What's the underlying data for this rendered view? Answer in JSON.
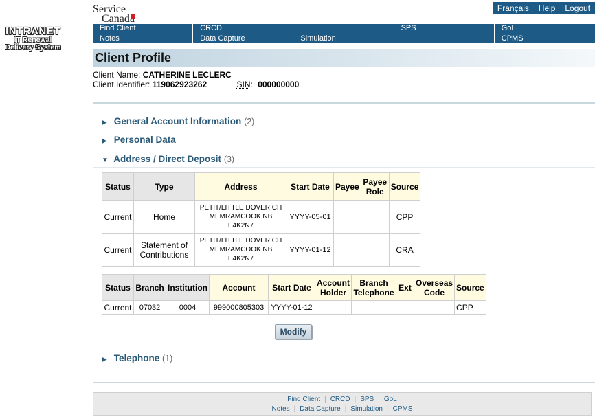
{
  "logo": {
    "intranet_big": "INTRANET",
    "intranet_line2": "IT Renewal",
    "intranet_line3": "Delivery System",
    "service_canada_line1": "Service",
    "service_canada_line2": "Canada"
  },
  "utility": {
    "francais": "Français",
    "help": "Help",
    "logout": "Logout"
  },
  "menu": {
    "row1": [
      "Find Client",
      "CRCD",
      "",
      "SPS",
      "GoL"
    ],
    "row2": [
      "Notes",
      "Data Capture",
      "Simulation",
      "",
      "CPMS"
    ]
  },
  "page_title": "Client Profile",
  "client": {
    "name_label": "Client Name:",
    "name": "CATHERINE LECLERC",
    "id_label": "Client Identifier:",
    "id": "119062923262",
    "sin_label": "SIN",
    "sin_colon": ":",
    "sin": "000000000"
  },
  "sections": {
    "general": {
      "arrow": "▶",
      "label": "General Account Information",
      "count": "(2)"
    },
    "personal": {
      "arrow": "▶",
      "label": "Personal Data",
      "count": ""
    },
    "address": {
      "arrow": "▼",
      "label": "Address / Direct Deposit",
      "count": "(3)"
    },
    "telephone": {
      "arrow": "▶",
      "label": "Telephone",
      "count": "(1)"
    }
  },
  "address_table": {
    "headers": [
      "Status",
      "Type",
      "Address",
      "Start Date",
      "Payee",
      "Payee Role",
      "Source"
    ],
    "rows": [
      {
        "status": "Current",
        "type": "Home",
        "address_l1": "PETIT/LITTLE DOVER CH",
        "address_l2": "MEMRAMCOOK NB",
        "address_l3": "E4K2N7",
        "start_date": "YYYY-05-01",
        "payee": "",
        "payee_role": "",
        "source": "CPP"
      },
      {
        "status": "Current",
        "type": "Statement of Contributions",
        "address_l1": "PETIT/LITTLE DOVER CH",
        "address_l2": "MEMRAMCOOK NB",
        "address_l3": "E4K2N7",
        "start_date": "YYYY-01-12",
        "payee": "",
        "payee_role": "",
        "source": "CRA"
      }
    ]
  },
  "deposit_table": {
    "headers": [
      "Status",
      "Branch",
      "Institution",
      "Account",
      "Start Date",
      "Account Holder",
      "Branch Telephone",
      "Ext",
      "Overseas Code",
      "Source"
    ],
    "rows": [
      {
        "status": "Current",
        "branch": "07032",
        "institution": "0004",
        "account": "999000805303",
        "start_date": "YYYY-01-12",
        "holder": "",
        "telephone": "",
        "ext": "",
        "overseas": "",
        "source": "CPP"
      }
    ]
  },
  "modify_label": "Modify",
  "footer": {
    "row1": [
      "Find Client",
      "CRCD",
      "SPS",
      "GoL"
    ],
    "row2": [
      "Notes",
      "Data Capture",
      "Simulation",
      "CPMS"
    ]
  }
}
